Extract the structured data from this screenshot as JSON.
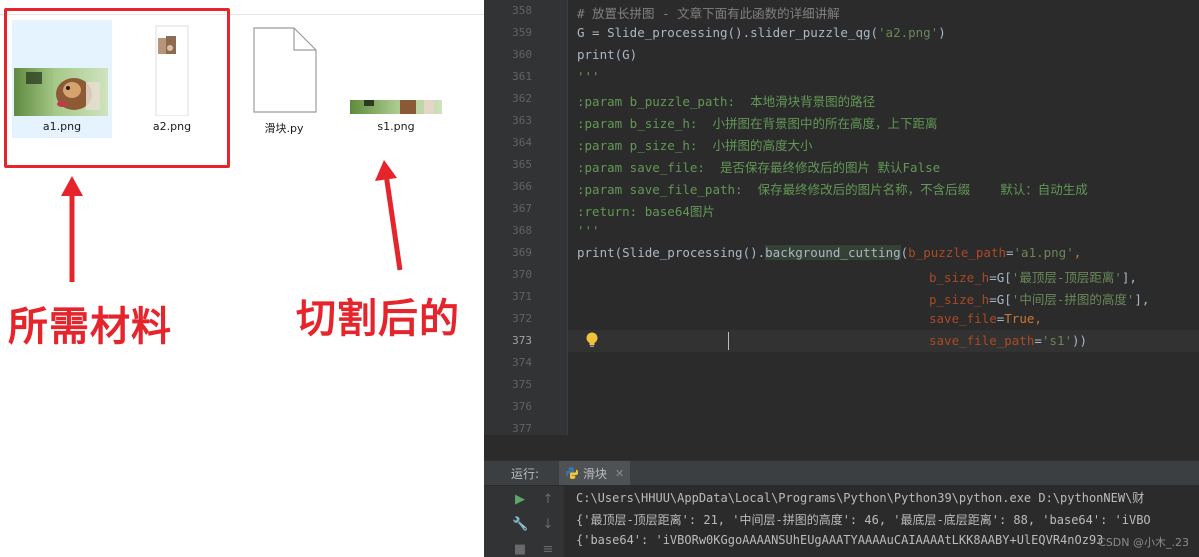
{
  "explorer": {
    "files": [
      {
        "name": "a1.png",
        "kind": "image-chipmunk-wide",
        "selected": true
      },
      {
        "name": "a2.png",
        "kind": "image-puzzle-strip",
        "selected": true
      },
      {
        "name": "滑块.py",
        "kind": "python-file-icon",
        "selected": false
      },
      {
        "name": "s1.png",
        "kind": "image-chipmunk-thin",
        "selected": false
      }
    ],
    "annotation_left": "所需材料",
    "annotation_right": "切割后的",
    "accent": "#e5242b"
  },
  "editor": {
    "line_numbers": [
      "358",
      "359",
      "360",
      "361",
      "362",
      "363",
      "364",
      "365",
      "366",
      "367",
      "368",
      "369",
      "370",
      "371",
      "372",
      "373",
      "374",
      "375",
      "376",
      "377"
    ],
    "current_line": "373",
    "lines": {
      "l358": "# 放置长拼图 - 文章下面有此函数的详细讲解",
      "l359_a": "G = Slide_processing().slider_puzzle_qg(",
      "l359_b": "'a2.png'",
      "l359_c": ")",
      "l360": "print(G)",
      "l361": "'''",
      "l362": ":param b_puzzle_path:  本地滑块背景图的路径",
      "l363": ":param b_size_h:  小拼图在背景图中的所在高度，上下距离",
      "l364": ":param p_size_h:  小拼图的高度大小",
      "l365": ":param save_file:  是否保存最终修改后的图片 默认False",
      "l366": ":param save_file_path:  保存最终修改后的图片名称，不含后缀    默认：自动生成",
      "l367": ":return: base64图片",
      "l368": "'''",
      "l369_a": "print(Slide_processing().",
      "l369_b": "background_cutting",
      "l369_c": "(",
      "l369_d": "b_puzzle_path",
      "l369_e": "=",
      "l369_f": "'a1.png'",
      "l369_g": ",",
      "l370_a": "b_size_h",
      "l370_b": "=G[",
      "l370_c": "'最顶层-顶层距离'",
      "l370_d": "],",
      "l371_a": "p_size_h",
      "l371_b": "=G[",
      "l371_c": "'中间层-拼图的高度'",
      "l371_d": "],",
      "l372_a": "save_file",
      "l372_b": "=",
      "l372_c": "True",
      "l372_d": ",",
      "l373_a": "save_file_path",
      "l373_b": "=",
      "l373_c": "'s1'",
      "l373_d": "))"
    }
  },
  "run_panel": {
    "label": "运行:",
    "tab_name": "滑块",
    "output": [
      "C:\\Users\\HHUU\\AppData\\Local\\Programs\\Python\\Python39\\python.exe D:\\pythonNEW\\财",
      "{'最顶层-顶层距离': 21, '中间层-拼图的高度': 46, '最底层-底层距离': 88, 'base64': 'iVBO",
      "{'base64': 'iVBORw0KGgoAAAANSUhEUgAAATYAAAAuCAIAAAAtLKK8AABY+UlEQVR4nOz93"
    ],
    "watermark": "CSDN @小木_.23"
  }
}
